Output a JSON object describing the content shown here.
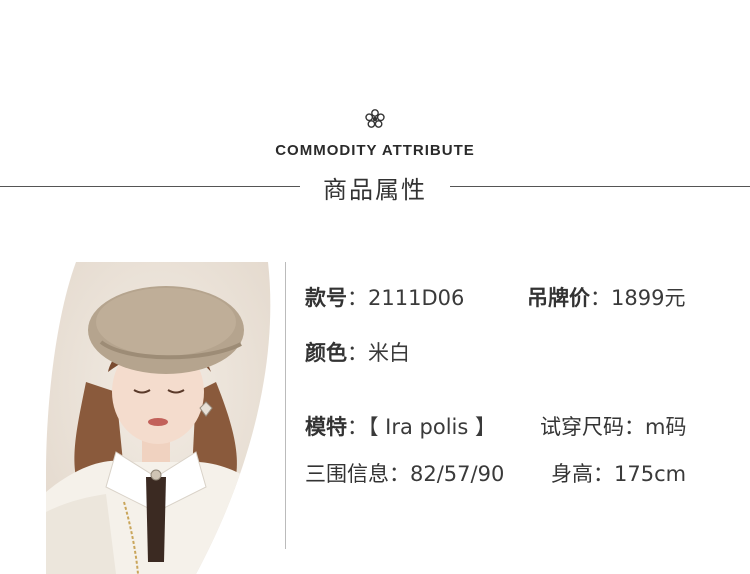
{
  "header": {
    "en_title": "COMMODITY ATTRIBUTE",
    "cn_title": "商品属性",
    "ornament_icon": "flower-icon"
  },
  "photo": {
    "description_icon": "model-photo"
  },
  "attributes": {
    "style_no_label": "款号",
    "style_no_value": "2111D06",
    "price_label": "吊牌价",
    "price_value": "1899元",
    "color_label": "颜色",
    "color_value": "米白",
    "model_label": "模特",
    "model_value": "【 Ira polis 】",
    "size_label": "试穿尺码",
    "size_value": "m码",
    "measure_label": "三围信息",
    "measure_value": "82/57/90",
    "height_label": "身高",
    "height_value": "175cm",
    "separator": "："
  },
  "colors": {
    "text": "#333333",
    "rule": "#555555",
    "beret": "#b5a48e",
    "coat": "#f3efe8"
  }
}
